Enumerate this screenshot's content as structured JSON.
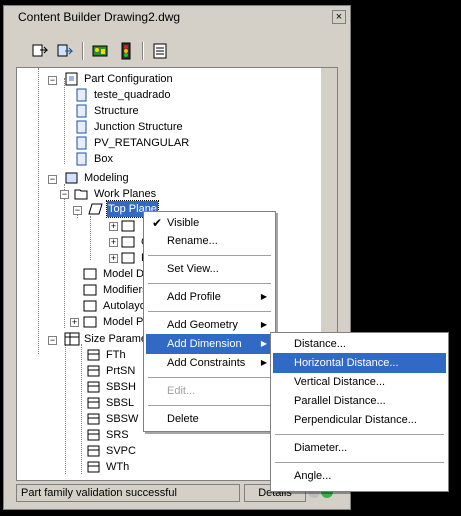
{
  "window": {
    "title": "Content Builder Drawing2.dwg",
    "close_glyph": "×"
  },
  "toolbar": {
    "icons": [
      "extract-icon",
      "publish-icon",
      "catalog-icon",
      "traffic-light-icon",
      "list-icon"
    ]
  },
  "tree": {
    "part_configuration": "Part Configuration",
    "teste_quadrado": "teste_quadrado",
    "structure": "Structure",
    "junction_structure": "Junction Structure",
    "pv_retangular": "PV_RETANGULAR",
    "box": "Box",
    "modeling": "Modeling",
    "work_planes": "Work Planes",
    "top_plane": "Top Plane",
    "sub1_partial": "",
    "sub2_partial": "C",
    "sub3_partial": "F",
    "model_dim": "Model Di",
    "modifiers": "Modifiers",
    "autolayout": "Autolayo",
    "model_params": "Model Pa",
    "size_parameters": "Size Parame",
    "params": [
      "FTh",
      "PrtSN",
      "SBSH",
      "SBSL",
      "SBSW",
      "SRS",
      "SVPC",
      "WTh"
    ]
  },
  "status": {
    "text": "Part family validation successful",
    "details_label": "Details"
  },
  "context_menu": {
    "visible": "Visible",
    "rename": "Rename...",
    "set_view": "Set View...",
    "add_profile": "Add Profile",
    "add_geometry": "Add Geometry",
    "add_dimension": "Add Dimension",
    "add_constraints": "Add Constraints",
    "edit": "Edit...",
    "delete": "Delete",
    "check_glyph": "✔",
    "arrow_glyph": "▶"
  },
  "dimension_submenu": {
    "distance": "Distance...",
    "horizontal_distance": "Horizontal Distance...",
    "vertical_distance": "Vertical Distance...",
    "parallel_distance": "Parallel Distance...",
    "perpendicular_distance": "Perpendicular Distance...",
    "diameter": "Diameter...",
    "angle": "Angle..."
  },
  "colors": {
    "highlight": "#316ac5",
    "chrome": "#d4d0c8",
    "status_green": "#3cb043",
    "status_grey": "#bdbdbd"
  }
}
